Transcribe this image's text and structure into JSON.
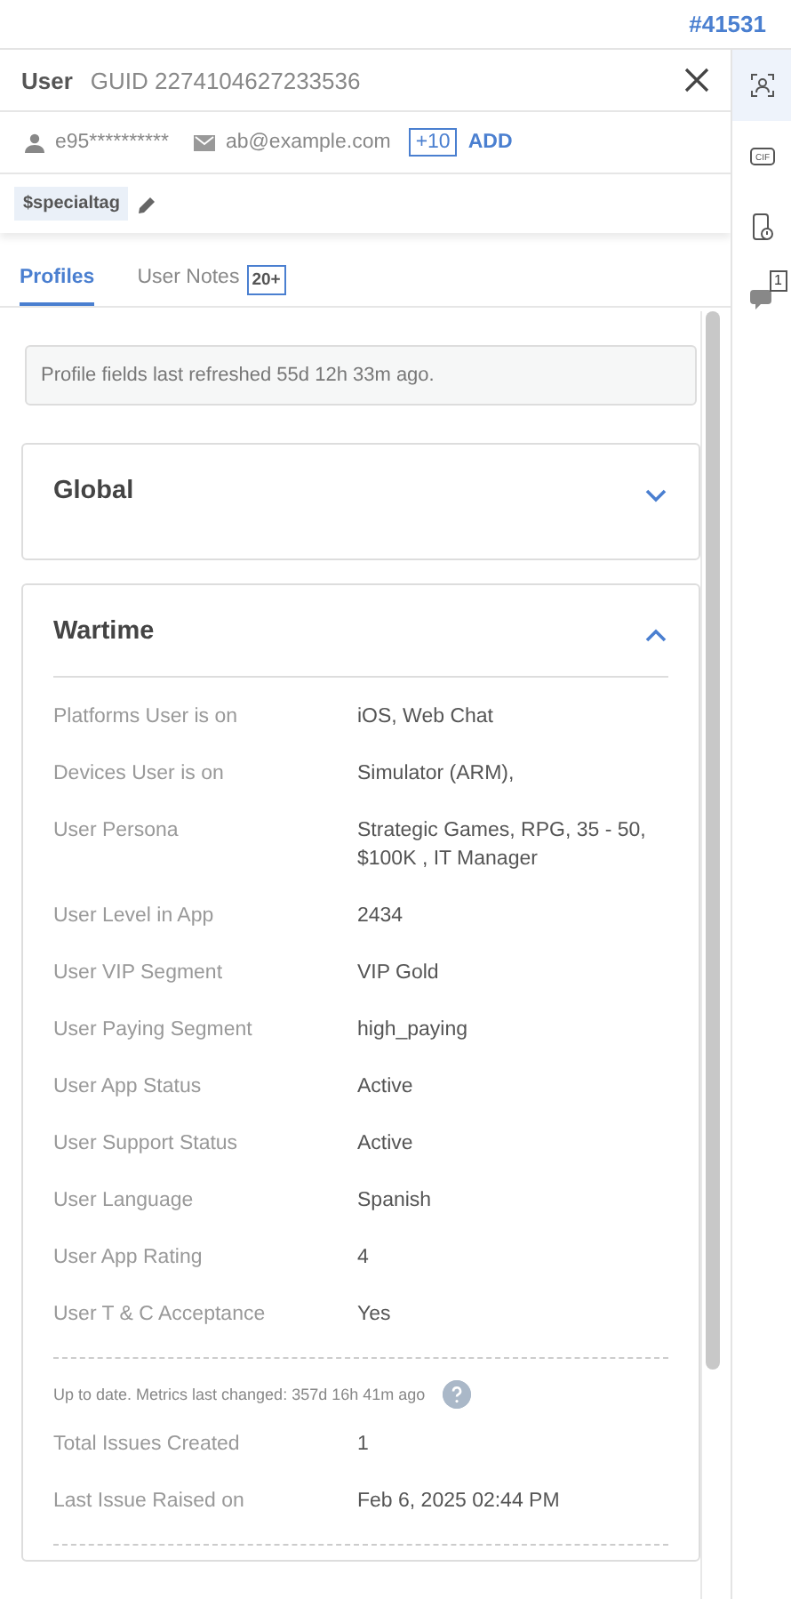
{
  "ticket_id": "#41531",
  "header": {
    "label": "User",
    "guid": "GUID 2274104627233536"
  },
  "contact": {
    "username": "e95**********",
    "email": "ab@example.com",
    "more_count": "+10",
    "add_label": "ADD"
  },
  "tags": [
    "$specialtag"
  ],
  "tabs": [
    {
      "label": "Profiles",
      "selected": true
    },
    {
      "label": "User Notes",
      "badge": "20+",
      "selected": false
    }
  ],
  "notice": "Profile fields last refreshed 55d 12h 33m ago.",
  "sections": [
    {
      "title": "Global",
      "expanded": false
    },
    {
      "title": "Wartime",
      "expanded": true,
      "fields": [
        {
          "label": "Platforms User is on",
          "value": "iOS, Web Chat"
        },
        {
          "label": "Devices User is on",
          "value": "Simulator (ARM),"
        },
        {
          "label": "User Persona",
          "value": "Strategic Games, RPG, 35 - 50, $100K , IT Manager"
        },
        {
          "label": "User Level in App",
          "value": "2434"
        },
        {
          "label": "User VIP Segment",
          "value": "VIP Gold"
        },
        {
          "label": "User Paying Segment",
          "value": "high_paying"
        },
        {
          "label": "User App Status",
          "value": "Active"
        },
        {
          "label": "User Support Status",
          "value": "Active"
        },
        {
          "label": "User Language",
          "value": "Spanish"
        },
        {
          "label": "User App Rating",
          "value": "4"
        },
        {
          "label": "User T & C Acceptance",
          "value": "Yes"
        }
      ],
      "metrics_note": "Up to date. Metrics last changed: 357d 16h 41m ago",
      "metrics": [
        {
          "label": "Total Issues Created",
          "value": "1"
        },
        {
          "label": "Last Issue Raised on",
          "value": "Feb 6, 2025 02:44 PM"
        }
      ]
    }
  ],
  "rail": [
    {
      "kind": "profile",
      "selected": true
    },
    {
      "kind": "gif",
      "icon_text": "CIF",
      "selected": false
    },
    {
      "kind": "device",
      "selected": false
    },
    {
      "kind": "chat",
      "badge": "1",
      "selected": false
    }
  ]
}
